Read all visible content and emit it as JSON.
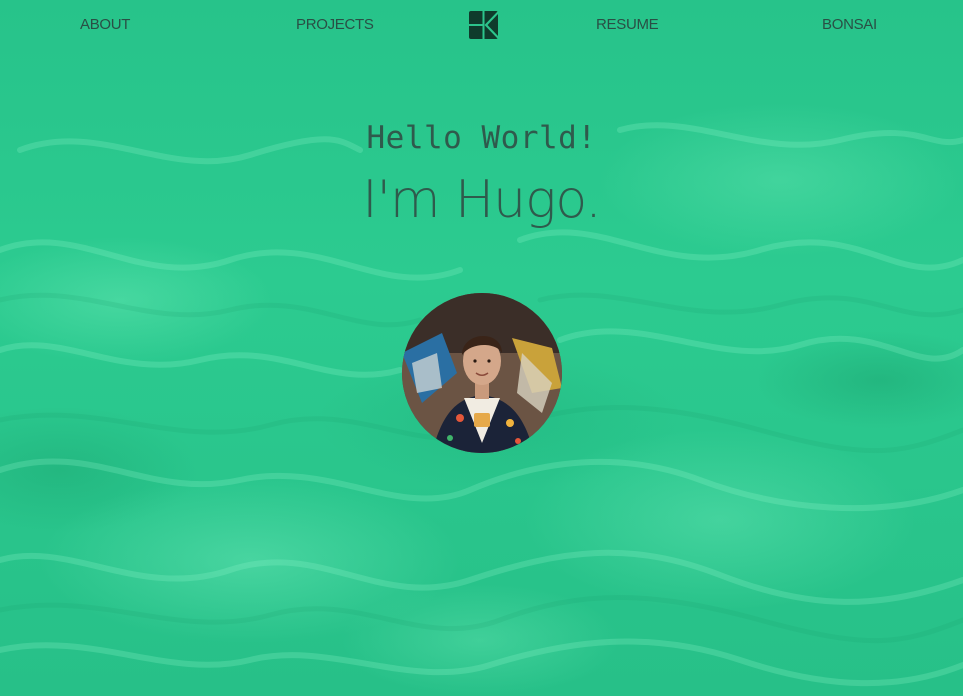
{
  "nav": {
    "about_label": "ABOUT",
    "projects_label": "PROJECTS",
    "resume_label": "RESUME",
    "bonsai_label": "BONSAI",
    "logo_icon": "monogram-logo-icon"
  },
  "hero": {
    "greeting": "Hello World!",
    "name": "I'm Hugo."
  },
  "avatar": {
    "icon": "profile-photo"
  },
  "colors": {
    "background": "#2cc48c",
    "text": "#2f5a4c",
    "nav_text": "#2a4f45",
    "logo": "#0f3b2c"
  }
}
